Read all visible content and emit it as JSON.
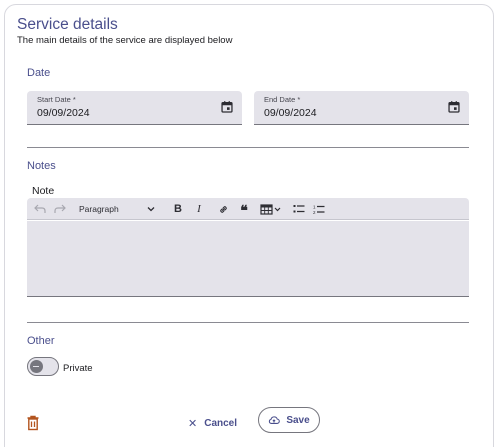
{
  "header": {
    "title": "Service details",
    "subtitle": "The main details of the service are displayed below"
  },
  "date_section": {
    "label": "Date",
    "start_date": {
      "label": "Start Date *",
      "value": "09/09/2024",
      "icon": "calendar-icon"
    },
    "end_date": {
      "label": "End Date *",
      "value": "09/09/2024",
      "icon": "calendar-icon"
    }
  },
  "notes_section": {
    "label": "Notes",
    "note_label": "Note",
    "toolbar": {
      "undo_icon": "undo-icon",
      "redo_icon": "redo-icon",
      "block_format": "Paragraph",
      "bold": "B",
      "italic": "I",
      "link_icon": "link-icon",
      "blockquote": "❝",
      "table_icon": "table-icon",
      "bulleted_list_icon": "bulleted-list-icon",
      "numbered_list_icon": "numbered-list-icon"
    },
    "editor_content": ""
  },
  "other_section": {
    "label": "Other",
    "private_label": "Private",
    "private_enabled": false
  },
  "actions": {
    "delete_icon": "trash-icon",
    "cancel_label": "Cancel",
    "save_label": "Save"
  },
  "colors": {
    "accent": "#4a4f8c",
    "field_background": "#e4e3ea",
    "delete": "#b3541e"
  }
}
